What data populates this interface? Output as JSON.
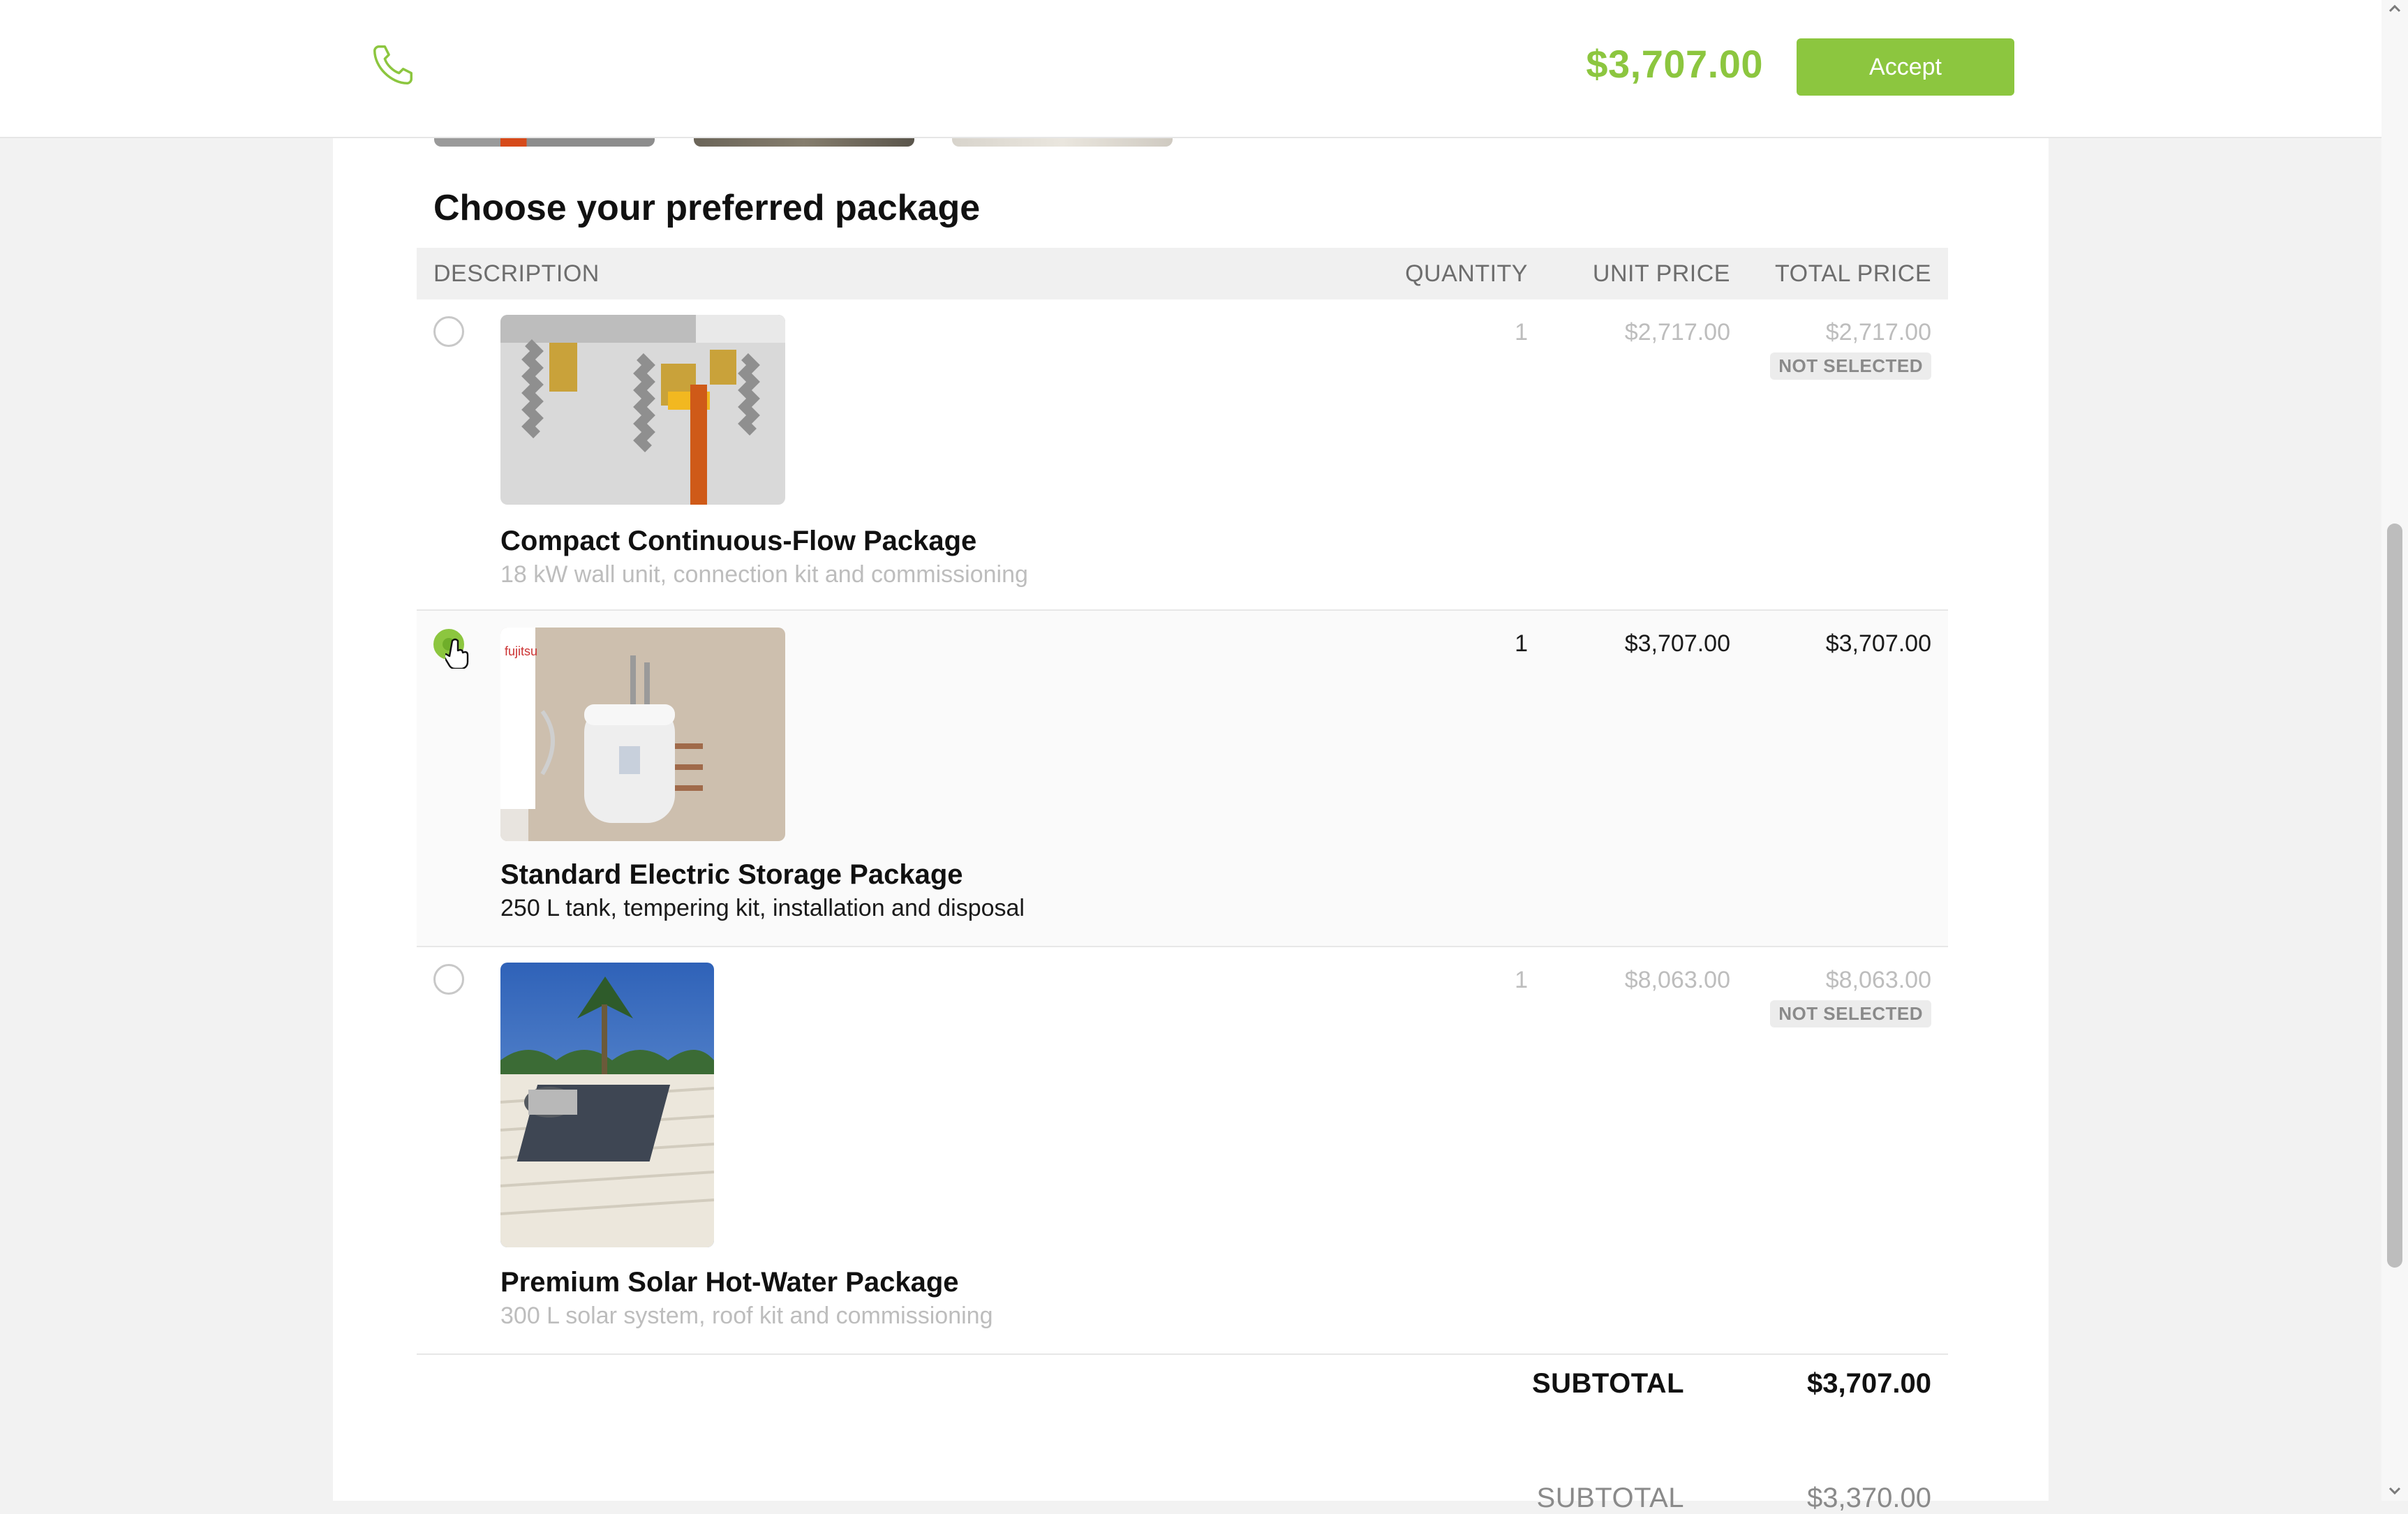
{
  "header": {
    "total": "$3,707.00",
    "accept_label": "Accept",
    "phone_icon": "phone-icon",
    "accent_color": "#8cc63f"
  },
  "section": {
    "title": "Choose your preferred package"
  },
  "table": {
    "headers": {
      "description": "DESCRIPTION",
      "quantity": "QUANTITY",
      "unit_price": "UNIT PRICE",
      "total_price": "TOTAL PRICE"
    },
    "rows": [
      {
        "name": "Compact Continuous-Flow Package",
        "description": "18 kW wall unit, connection kit and commissioning",
        "quantity": "1",
        "unit_price": "$2,717.00",
        "total_price": "$2,717.00",
        "badge": "NOT SELECTED",
        "selected": false
      },
      {
        "name": "Standard Electric Storage Package",
        "description": "250 L tank, tempering kit, installation and disposal",
        "quantity": "1",
        "unit_price": "$3,707.00",
        "total_price": "$3,707.00",
        "selected": true
      },
      {
        "name": "Premium Solar Hot-Water Package",
        "description": "300 L solar system, roof kit and commissioning",
        "quantity": "1",
        "unit_price": "$8,063.00",
        "total_price": "$8,063.00",
        "badge": "NOT SELECTED",
        "selected": false
      }
    ]
  },
  "summary": {
    "subtotal_label": "SUBTOTAL",
    "subtotal_value": "$3,707.00",
    "subtotal2_label": "SUBTOTAL",
    "subtotal2_value": "$3,370.00"
  }
}
